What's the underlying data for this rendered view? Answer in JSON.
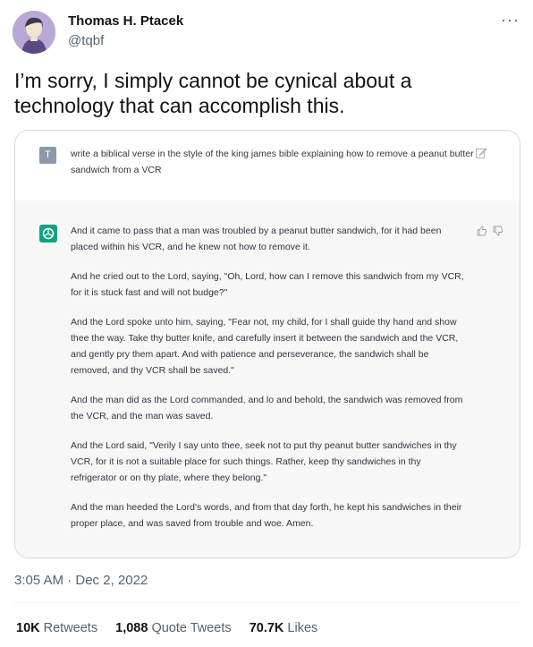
{
  "author": {
    "name": "Thomas H. Ptacek",
    "handle": "@tqbf"
  },
  "more_label": "···",
  "tweet_text": "I’m sorry, I simply cannot be cynical about a technology that can accomplish this.",
  "card": {
    "user_badge": "T",
    "prompt": "write a biblical verse in the style of the king james bible explaining how to remove a peanut butter sandwich from a VCR",
    "answer_paragraphs": [
      "And it came to pass that a man was troubled by a peanut butter sandwich, for it had been placed within his VCR, and he knew not how to remove it.",
      "And he cried out to the Lord, saying, \"Oh, Lord, how can I remove this sandwich from my VCR, for it is stuck fast and will not budge?\"",
      "And the Lord spoke unto him, saying, \"Fear not, my child, for I shall guide thy hand and show thee the way. Take thy butter knife, and carefully insert it between the sandwich and the VCR, and gently pry them apart. And with patience and perseverance, the sandwich shall be removed, and thy VCR shall be saved.\"",
      "And the man did as the Lord commanded, and lo and behold, the sandwich was removed from the VCR, and the man was saved.",
      "And the Lord said, \"Verily I say unto thee, seek not to put thy peanut butter sandwiches in thy VCR, for it is not a suitable place for such things. Rather, keep thy sandwiches in thy refrigerator or on thy plate, where they belong.\"",
      "And the man heeded the Lord's words, and from that day forth, he kept his sandwiches in their proper place, and was saved from trouble and woe. Amen."
    ]
  },
  "timestamp": "3:05 AM · Dec 2, 2022",
  "stats": {
    "retweets_count": "10K",
    "retweets_label": "Retweets",
    "quotes_count": "1,088",
    "quotes_label": "Quote Tweets",
    "likes_count": "70.7K",
    "likes_label": "Likes"
  },
  "colors": {
    "chatgpt_green": "#10a37f",
    "muted": "#536471"
  },
  "icons": [
    "avatar",
    "more-icon",
    "edit-icon",
    "chatgpt-logo-icon",
    "thumbs-up-icon",
    "thumbs-down-icon"
  ]
}
